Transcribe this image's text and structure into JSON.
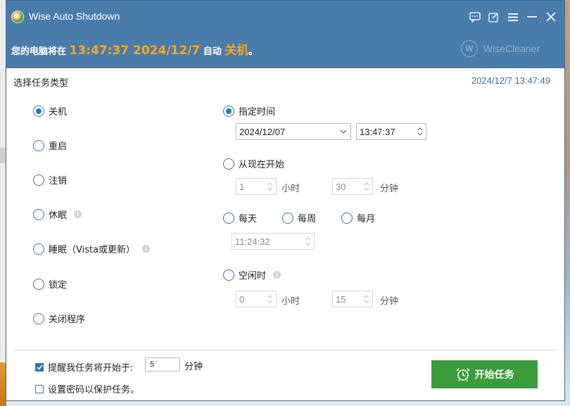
{
  "app": {
    "title": "Wise Auto Shutdown",
    "brand": "WiseCleaner",
    "brand_badge": "W"
  },
  "status": {
    "prefix": "您的电脑将在 ",
    "time": "13:47:37 2024/12/7",
    "middle": " 自动 ",
    "action": "关机",
    "suffix": "。",
    "highlight_color": "#ffa31a"
  },
  "header": {
    "section_label": "选择任务类型",
    "current_datetime": "2024/12/7 13:47:49"
  },
  "task_types": [
    {
      "label": "关机",
      "selected": true
    },
    {
      "label": "重启",
      "selected": false
    },
    {
      "label": "注销",
      "selected": false
    },
    {
      "label": "休眠",
      "selected": false
    },
    {
      "label": "睡眠（Vista或更新）",
      "selected": false
    },
    {
      "label": "锁定",
      "selected": false
    },
    {
      "label": "关闭程序",
      "selected": false
    }
  ],
  "schedule": {
    "specified_time": {
      "label": "指定时间",
      "selected": true,
      "date": "2024/12/07",
      "time": "13:47:37"
    },
    "from_now": {
      "label": "从现在开始",
      "selected": false,
      "hours": "1",
      "hours_unit": "小时",
      "minutes": "30",
      "minutes_unit": "分钟"
    },
    "recurring": {
      "options": [
        {
          "label": "每天",
          "selected": false
        },
        {
          "label": "每周",
          "selected": false
        },
        {
          "label": "每月",
          "selected": false
        }
      ],
      "time": "11:24:32"
    },
    "idle": {
      "label": "空闲时",
      "selected": false,
      "hours": "0",
      "hours_unit": "小时",
      "minutes": "15",
      "minutes_unit": "分钟"
    }
  },
  "footer": {
    "remind": {
      "label": "提醒我任务将开始于:",
      "checked": true,
      "value": "5",
      "unit": "分钟"
    },
    "password": {
      "label": "设置密码以保护任务。",
      "checked": false
    },
    "start_button": "开始任务"
  },
  "colors": {
    "titlebar": "#4a7cab",
    "accent": "#2d75c0",
    "start_button": "#3b9c3b"
  },
  "icons": [
    "app-logo-icon",
    "feedback-icon",
    "edit-icon",
    "menu-icon",
    "minimize-icon",
    "close-icon",
    "info-icon",
    "chevron-down-icon",
    "spin-up-icon",
    "spin-down-icon",
    "alarm-clock-icon"
  ]
}
